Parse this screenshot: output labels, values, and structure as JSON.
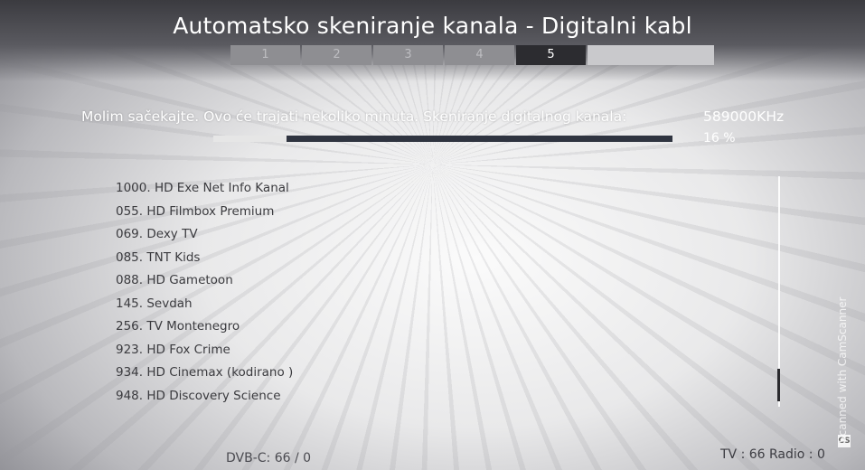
{
  "header": {
    "title": "Automatsko skeniranje kanala  - Digitalni kabl",
    "steps": [
      "1",
      "2",
      "3",
      "4",
      "5"
    ],
    "active_step": "5"
  },
  "status": {
    "message": "Molim sačekajte. Ovo će trajati nekoliko minuta.  Skeniranje digitalnog kanala:",
    "frequency": "589000KHz",
    "percent_label": "16 %",
    "progress_fraction": 0.16
  },
  "channels": [
    "1000. HD Exe Net Info Kanal",
    "055. HD Filmbox Premium",
    "069. Dexy TV",
    "085. TNT Kids",
    "088. HD Gametoon",
    "145. Sevdah",
    "256. TV Montenegro",
    "923. HD Fox Crime",
    "934. HD Cinemax (kodirano )",
    "948. HD Discovery Science"
  ],
  "footer": {
    "dvb": "DVB-C: 66 / 0",
    "counts": "TV : 66  Radio :  0"
  },
  "watermark": {
    "text": "Scanned with CamScanner",
    "logo": "CS"
  }
}
